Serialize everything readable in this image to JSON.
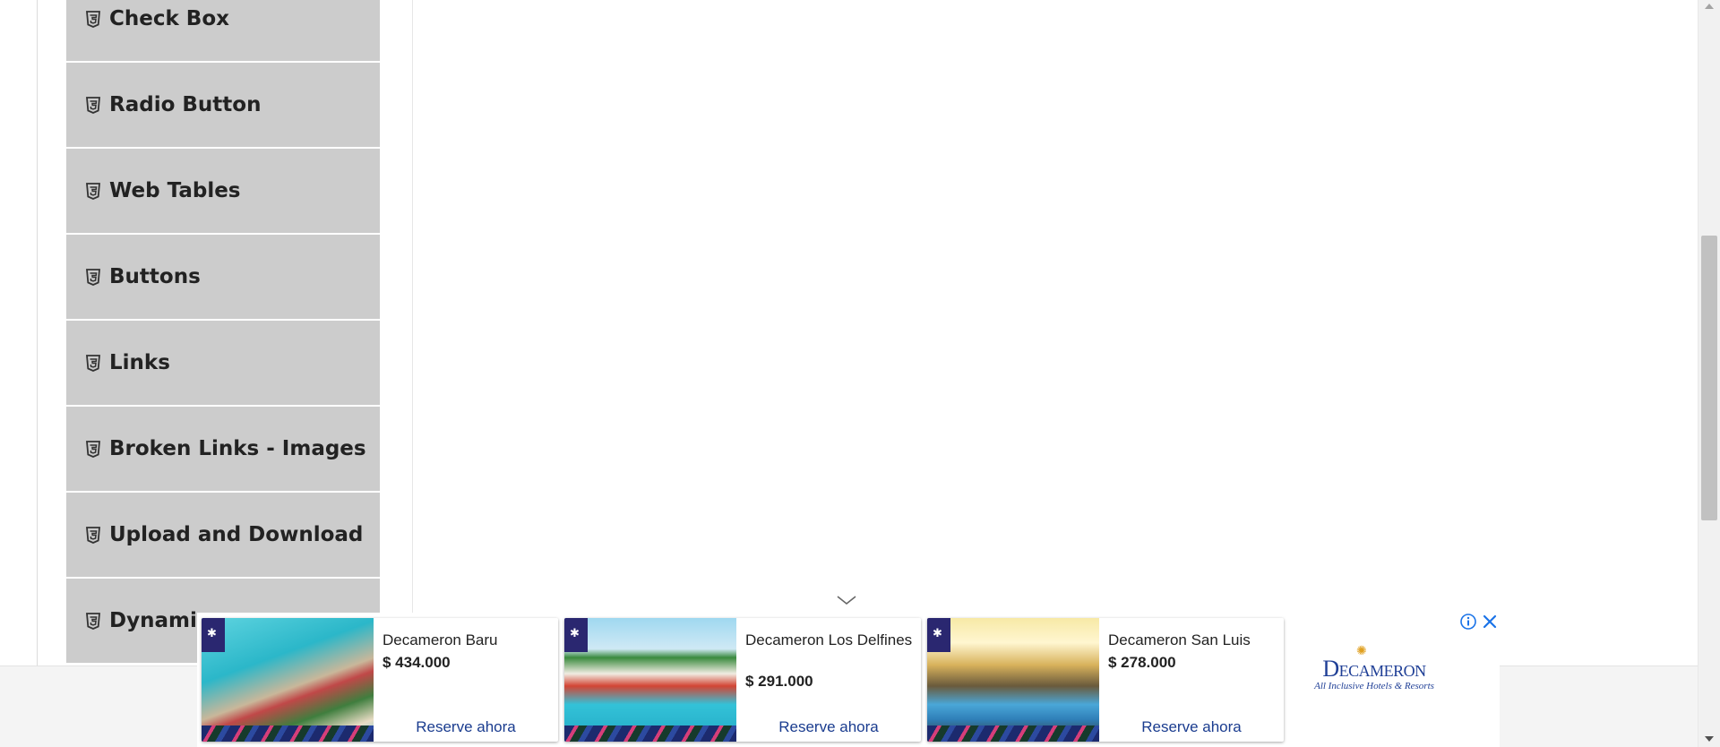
{
  "sidebar": {
    "items": [
      {
        "label": "Check Box",
        "icon": "html5-icon"
      },
      {
        "label": "Radio Button",
        "icon": "html5-icon"
      },
      {
        "label": "Web Tables",
        "icon": "html5-icon"
      },
      {
        "label": "Buttons",
        "icon": "html5-icon"
      },
      {
        "label": "Links",
        "icon": "html5-icon"
      },
      {
        "label": "Broken Links - Images",
        "icon": "html5-icon"
      },
      {
        "label": "Upload and Download",
        "icon": "html5-icon"
      },
      {
        "label": "Dynamic",
        "icon": "html5-icon"
      }
    ]
  },
  "ad": {
    "cards": [
      {
        "name": "Decameron Baru",
        "price": "$ 434.000",
        "cta": "Reserve ahora"
      },
      {
        "name": "Decameron Los Delfines",
        "price": "$ 291.000",
        "cta": "Reserve ahora"
      },
      {
        "name": "Decameron San Luis",
        "price": "$ 278.000",
        "cta": "Reserve ahora"
      }
    ],
    "brand_name": "Decameron",
    "brand_tagline": "All Inclusive Hotels & Resorts"
  },
  "colors": {
    "menu_bg": "#cccccc",
    "ad_link": "#1a3c8f",
    "adchoices": "#1a73e8"
  }
}
